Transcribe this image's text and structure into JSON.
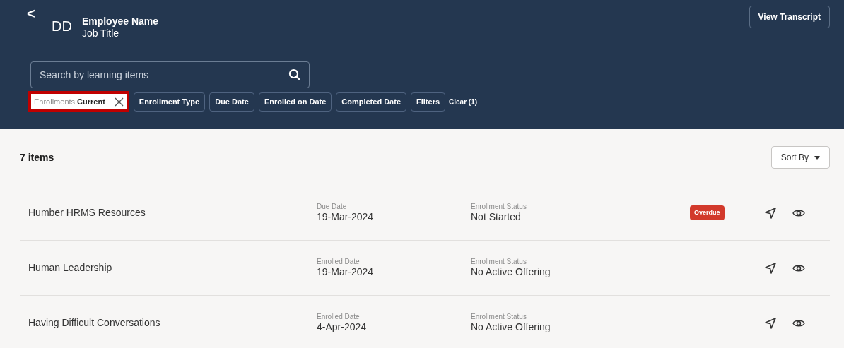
{
  "header": {
    "back": "<",
    "initials": "DD",
    "name": "Employee Name",
    "job_title": "Job Title",
    "view_transcript": "View Transcript"
  },
  "search": {
    "placeholder": "Search by learning items"
  },
  "filters": [
    {
      "kind": "applied",
      "label": "Enrollments",
      "value": "Current",
      "highlighted": true
    },
    {
      "kind": "button",
      "label": "Enrollment Type"
    },
    {
      "kind": "button",
      "label": "Due Date"
    },
    {
      "kind": "button",
      "label": "Enrolled on Date"
    },
    {
      "kind": "button",
      "label": "Completed Date"
    },
    {
      "kind": "button",
      "label": "Filters"
    },
    {
      "kind": "clear",
      "label": "Clear (1)"
    }
  ],
  "count": "7 items",
  "sort": "Sort By",
  "rows": [
    {
      "title": "Humber HRMS Resources",
      "date_label": "Due Date",
      "date": "19-Mar-2024",
      "status_label": "Enrollment Status",
      "status": "Not Started",
      "badge": "Overdue"
    },
    {
      "title": "Human Leadership",
      "date_label": "Enrolled Date",
      "date": "19-Mar-2024",
      "status_label": "Enrollment Status",
      "status": "No Active Offering"
    },
    {
      "title": "Having Difficult Conversations",
      "date_label": "Enrolled Date",
      "date": "4-Apr-2024",
      "status_label": "Enrollment Status",
      "status": "No Active Offering"
    }
  ]
}
